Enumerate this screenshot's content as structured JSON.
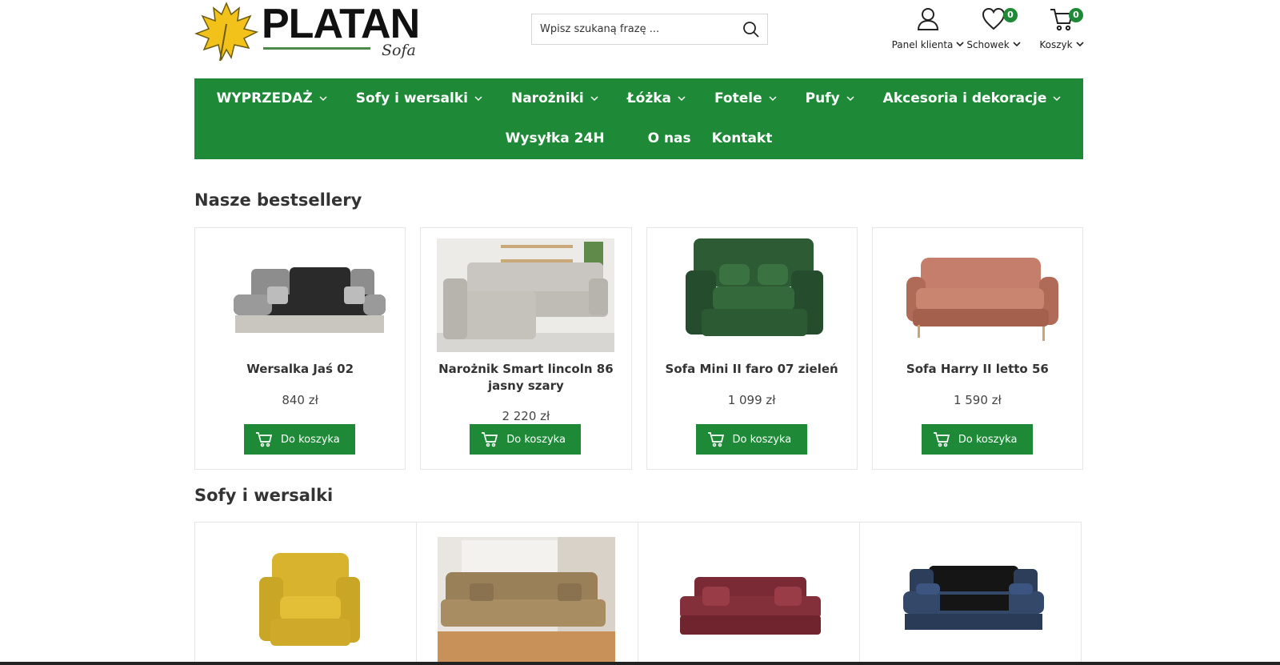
{
  "brand": {
    "name": "PLATAN",
    "tagline": "Sofa"
  },
  "search": {
    "placeholder": "Wpisz szukaną frazę ..."
  },
  "header_actions": [
    {
      "label": "Panel klienta",
      "icon": "user-icon"
    },
    {
      "label": "Schowek",
      "icon": "heart-icon",
      "badge": "0"
    },
    {
      "label": "Koszyk",
      "icon": "cart-icon",
      "badge": "0"
    }
  ],
  "nav": {
    "row1": [
      "WYPRZEDAŻ",
      "Sofy i wersalki",
      "Narożniki",
      "Łóżka",
      "Fotele",
      "Pufy",
      "Akcesoria i dekoracje"
    ],
    "row2": [
      "Wysyłka 24H",
      "O nas",
      "Kontakt"
    ]
  },
  "sections": {
    "bestsellers": "Nasze bestsellery",
    "sofas": "Sofy i wersalki"
  },
  "add_to_cart_label": "Do koszyka",
  "bestsellers": [
    {
      "name": "Wersalka Jaś 02",
      "price": "840 zł"
    },
    {
      "name": "Narożnik Smart lincoln 86 jasny szary",
      "price": "2 220 zł"
    },
    {
      "name": "Sofa Mini II faro 07 zieleń",
      "price": "1 099 zł"
    },
    {
      "name": "Sofa Harry II letto 56",
      "price": "1 590 zł"
    }
  ],
  "colors": {
    "brand_green": "#1e8a37",
    "logo_leaf": "#f2c21b"
  }
}
